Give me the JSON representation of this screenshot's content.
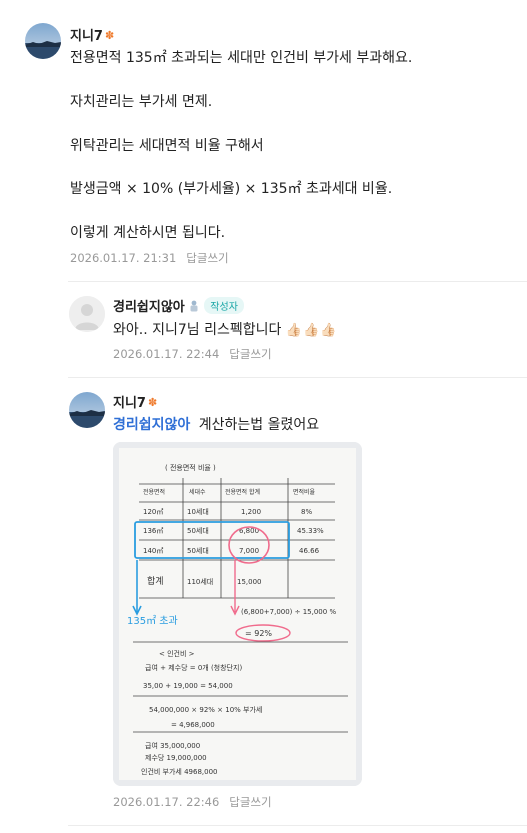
{
  "comments": [
    {
      "nickname": "지니7",
      "badge_icon": "flower-badge",
      "lines": [
        "전용면적 135㎡ 초과되는 세대만 인건비 부가세 부과해요.",
        "자치관리는 부가세 면제.",
        "위탁관리는 세대면적 비율 구해서",
        "발생금액 × 10% (부가세율) × 135㎡ 초과세대 비율.",
        "이렇게 계산하시면 됩니다."
      ],
      "date": "2026.01.17. 21:31",
      "reply_label": "답글쓰기"
    },
    {
      "nickname": "경리쉽지않아",
      "badge_icon": "user-level-badge",
      "author_tag": "작성자",
      "text": "와아.. 지니7님 리스펙합니다",
      "emoji": "👍🏻👍🏻👍🏻",
      "date": "2026.01.17. 22:44",
      "reply_label": "답글쓰기"
    },
    {
      "nickname": "지니7",
      "badge_icon": "flower-badge",
      "mention": "경리쉽지않아",
      "text": "계산하는법 올렸어요",
      "date": "2026.01.17. 22:46",
      "reply_label": "답글쓰기"
    }
  ],
  "photo": {
    "title": "( 전용면적 비율 )",
    "headers": [
      "전용면적",
      "세대수",
      "전용면적 합계",
      "면적비율"
    ],
    "rows": [
      [
        "120㎡",
        "10세대",
        "1,200",
        "8%"
      ],
      [
        "136㎡",
        "50세대",
        "6,800",
        "45.33%"
      ],
      [
        "140㎡",
        "50세대",
        "7,000",
        "46.66"
      ],
      [
        "합계",
        "110세대",
        "15,000",
        ""
      ]
    ],
    "side_note": "135㎡ 초과",
    "formula": "(6,800+7,000) ÷ 15,000 %",
    "formula_result": "= 92%",
    "section_label": "< 인건비 >",
    "calc_lines": [
      "급여 + 제수당 = 0개 (청창단지)",
      "35,00 + 19,000 = 54,000",
      "54,000,000 × 92% × 10% 부가세",
      "= 4,968,000",
      "급여 35,000,000",
      "제수당 19,000,000",
      "인건비 부가세 4968,000"
    ]
  }
}
